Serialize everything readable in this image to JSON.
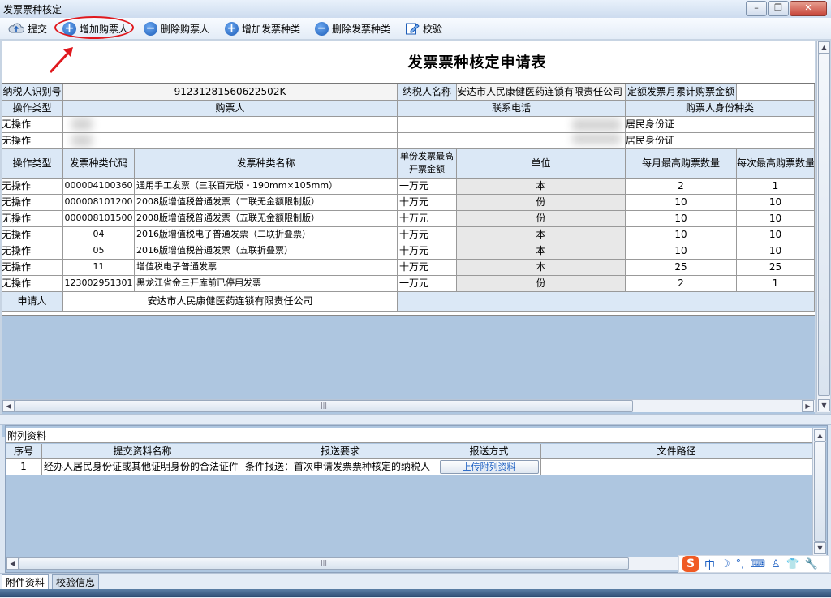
{
  "window": {
    "title": "发票票种核定",
    "controls": [
      "–",
      "❐",
      "✕"
    ]
  },
  "toolbar": {
    "items": [
      {
        "label": "提交",
        "icon": "submit-cloud-icon"
      },
      {
        "label": "增加购票人",
        "icon": "plus-icon"
      },
      {
        "label": "删除购票人",
        "icon": "minus-icon"
      },
      {
        "label": "增加发票种类",
        "icon": "plus-icon"
      },
      {
        "label": "删除发票种类",
        "icon": "minus-icon"
      },
      {
        "label": "校验",
        "icon": "edit-check-icon"
      }
    ]
  },
  "form": {
    "title": "发票票种核定申请表",
    "taxpayer_id_label": "纳税人识别号",
    "taxpayer_id": "91231281560622502K",
    "taxpayer_name_label": "纳税人名称",
    "taxpayer_name": "安达市人民康健医药连锁有限责任公司",
    "monthly_amount_label": "定额发票月累计购票金额",
    "buyer_headers": [
      "操作类型",
      "购票人",
      "联系电话",
      "购票人身份种类"
    ],
    "buyers": [
      {
        "op": "无操作",
        "id_type": "居民身份证"
      },
      {
        "op": "无操作",
        "id_type": "居民身份证"
      }
    ],
    "invoice_headers": [
      "操作类型",
      "发票种类代码",
      "发票种类名称",
      "单份发票最高开票金额",
      "单位",
      "每月最高购票数量",
      "每次最高购票数量"
    ],
    "invoices": [
      {
        "op": "无操作",
        "code": "000004100360",
        "name": "通用手工发票（三联百元版・190mm×105mm）",
        "max": "一万元",
        "unit": "本",
        "monthly": "2",
        "each": "1"
      },
      {
        "op": "无操作",
        "code": "000008101200",
        "name": "2008版增值税普通发票（二联无金额限制版）",
        "max": "十万元",
        "unit": "份",
        "monthly": "10",
        "each": "10"
      },
      {
        "op": "无操作",
        "code": "000008101500",
        "name": "2008版增值税普通发票（五联无金额限制版）",
        "max": "十万元",
        "unit": "份",
        "monthly": "10",
        "each": "10"
      },
      {
        "op": "无操作",
        "code": "04",
        "name": "2016版增值税电子普通发票（二联折叠票）",
        "max": "十万元",
        "unit": "本",
        "monthly": "10",
        "each": "10"
      },
      {
        "op": "无操作",
        "code": "05",
        "name": "2016版增值税普通发票（五联折叠票）",
        "max": "十万元",
        "unit": "本",
        "monthly": "10",
        "each": "10"
      },
      {
        "op": "无操作",
        "code": "11",
        "name": "增值税电子普通发票",
        "max": "十万元",
        "unit": "本",
        "monthly": "25",
        "each": "25"
      },
      {
        "op": "无操作",
        "code": "123002951301",
        "name": "黑龙江省金三开库前已停用发票",
        "max": "一万元",
        "unit": "份",
        "monthly": "2",
        "each": "1"
      }
    ],
    "applicant_label": "申请人",
    "applicant": "安达市人民康健医药连锁有限责任公司"
  },
  "attachments": {
    "title": "附列资料",
    "headers": [
      "序号",
      "提交资料名称",
      "报送要求",
      "报送方式",
      "文件路径"
    ],
    "rows": [
      {
        "no": "1",
        "name": "经办人居民身份证或其他证明身份的合法证件",
        "req": "条件报送：首次申请发票票种核定的纳税人",
        "button": "上传附列资料"
      }
    ]
  },
  "bottom_tabs": [
    "附件资料",
    "校验信息"
  ],
  "ime": {
    "mode": "中"
  },
  "colors": {
    "header_bg": "#dbe8f6",
    "pane_bg": "#aec6e0",
    "highlight_red": "#e0181d"
  }
}
